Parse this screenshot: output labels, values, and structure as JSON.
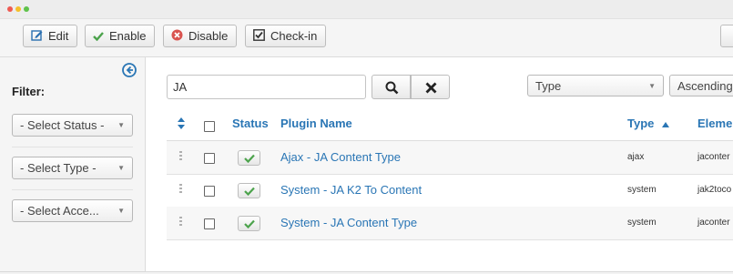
{
  "toolbar": {
    "edit_label": "Edit",
    "enable_label": "Enable",
    "disable_label": "Disable",
    "checkin_label": "Check-in"
  },
  "sidebar": {
    "filter_label": "Filter:",
    "selects": [
      {
        "value": "- Select Status -"
      },
      {
        "value": "- Select Type -"
      },
      {
        "value": "- Select Acce..."
      }
    ]
  },
  "search": {
    "value": "JA",
    "search_icon": "search-icon",
    "clear_icon": "close-icon"
  },
  "sort": {
    "field_value": "Type",
    "direction_value": "Ascending"
  },
  "table": {
    "headers": {
      "status": "Status",
      "plugin_name": "Plugin Name",
      "type": "Type",
      "element": "Eleme"
    },
    "rows": [
      {
        "name": "Ajax - JA Content Type",
        "type": "ajax",
        "element": "jaconter"
      },
      {
        "name": "System - JA K2 To Content",
        "type": "system",
        "element": "jak2toco"
      },
      {
        "name": "System - JA Content Type",
        "type": "system",
        "element": "jaconter"
      }
    ]
  },
  "colors": {
    "link": "#2a76b5",
    "enabled_check": "#4ca34c",
    "disable_icon": "#d9534f"
  }
}
